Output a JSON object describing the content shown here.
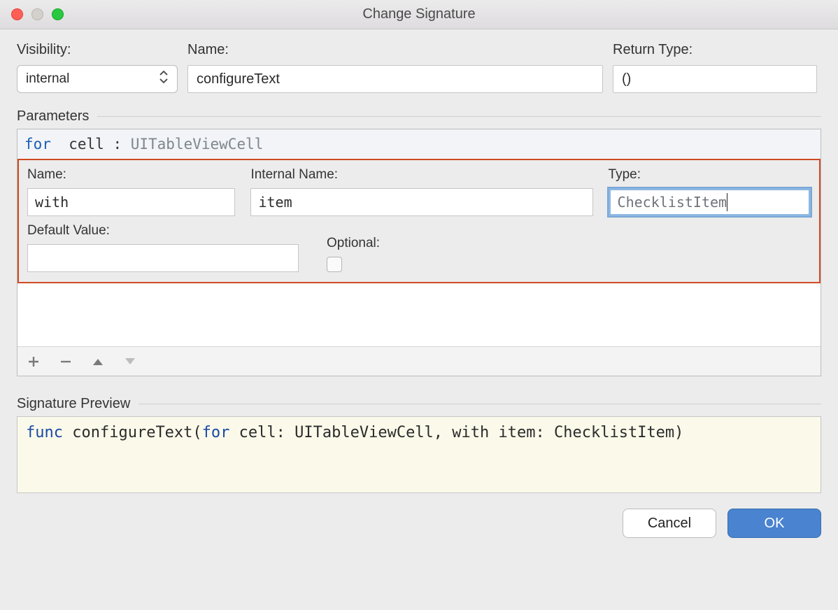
{
  "window": {
    "title": "Change Signature"
  },
  "labels": {
    "visibility": "Visibility:",
    "name": "Name:",
    "return_type": "Return Type:",
    "parameters": "Parameters",
    "signature_preview": "Signature Preview"
  },
  "visibility": {
    "value": "internal"
  },
  "name": {
    "value": "configureText"
  },
  "return_type": {
    "value": "()"
  },
  "params_list": {
    "row_keyword": "for",
    "row_tail": "  cell : ",
    "row_type": "UITableViewCell"
  },
  "param_editor": {
    "name_label": "Name:",
    "internal_label": "Internal Name:",
    "type_label": "Type:",
    "default_label": "Default Value:",
    "optional_label": "Optional:",
    "name_value": "with",
    "internal_value": "item",
    "type_value": "ChecklistItem",
    "default_value": ""
  },
  "preview": {
    "kw1": "func ",
    "seg1": "configureText(",
    "kw2": "for ",
    "seg2": "cell: UITableViewCell, with item: ChecklistItem)"
  },
  "footer": {
    "cancel": "Cancel",
    "ok": "OK"
  }
}
